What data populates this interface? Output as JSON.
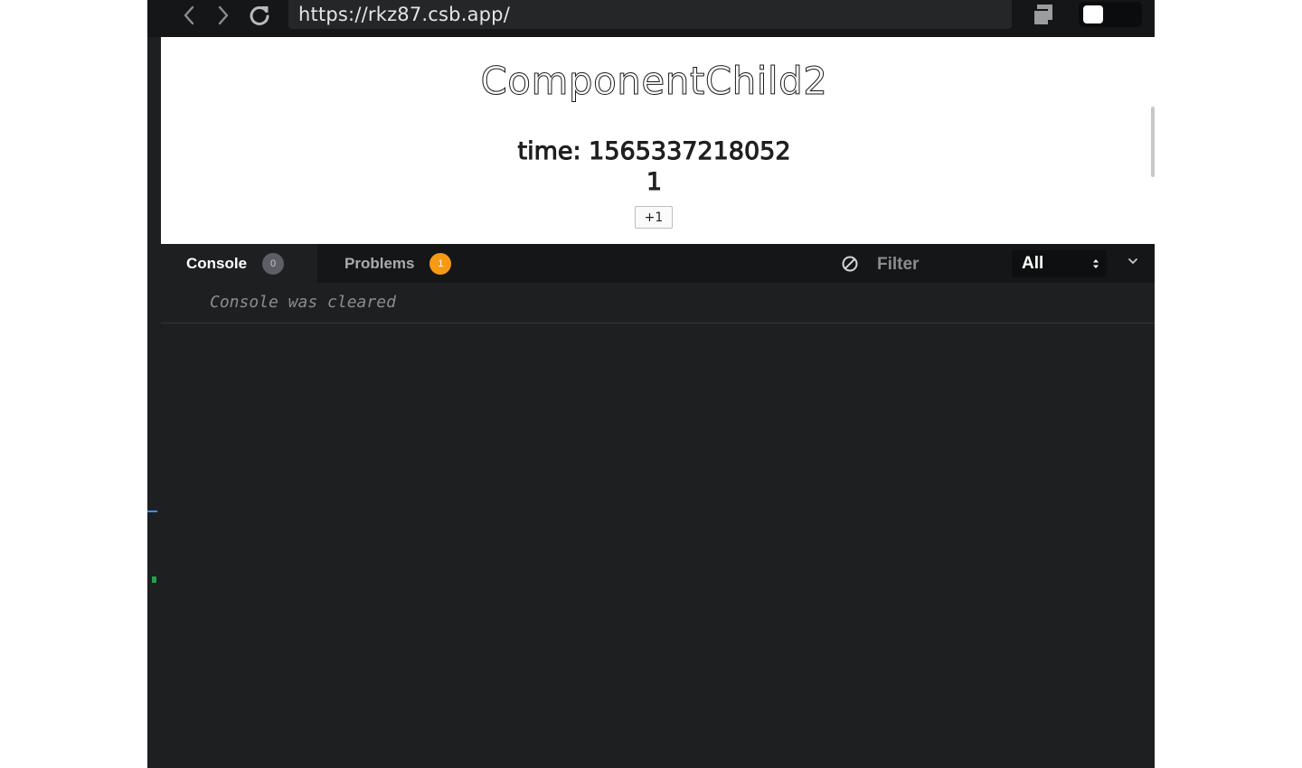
{
  "browser": {
    "url": "https://rkz87.csb.app/"
  },
  "preview": {
    "heading": "ComponentChild2",
    "time_line": "time: 1565337218052",
    "count": "1",
    "button_label": "+1"
  },
  "devtools": {
    "tabs": [
      {
        "label": "Console",
        "badge": "0"
      },
      {
        "label": "Problems",
        "badge": "1"
      }
    ],
    "filter_placeholder": "Filter",
    "level": "All",
    "console_message": "Console was cleared"
  },
  "colors": {
    "panel_bg": "#1d1f21",
    "tabbar_bg": "#151618",
    "problems_badge": "#f59a12"
  },
  "icons": [
    "back-arrow-icon",
    "forward-arrow-icon",
    "reload-icon",
    "new-window-icon",
    "clear-console-icon",
    "select-arrows-icon",
    "chevron-down-icon",
    "mouse-cursor-icon"
  ]
}
